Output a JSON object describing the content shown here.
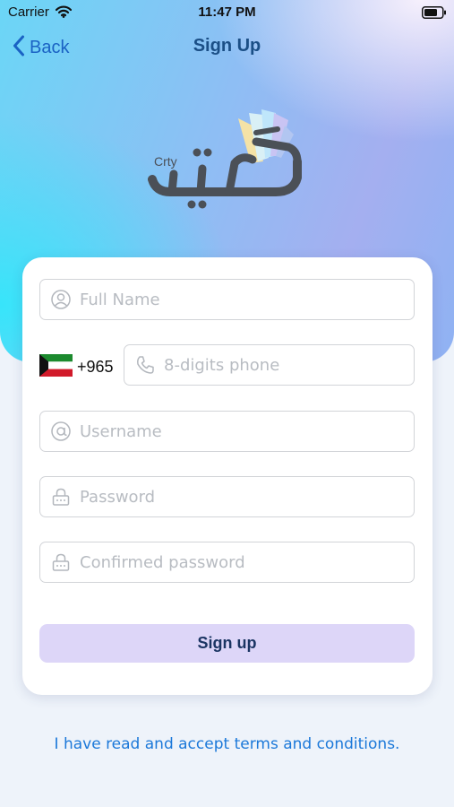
{
  "status_bar": {
    "carrier": "Carrier",
    "time": "11:47 PM",
    "icons": [
      "wifi-icon",
      "battery-icon"
    ]
  },
  "nav": {
    "back_label": "Back",
    "title": "Sign Up"
  },
  "logo": {
    "latin_text": "Crty",
    "arabic_text": "كرتي",
    "colors": {
      "wordmark": "#4b5057",
      "fan": [
        "#f4e2a6",
        "#d9f0f6",
        "#bfe6fb",
        "#c9c4f3",
        "#b2c6f1"
      ]
    }
  },
  "form": {
    "full_name": {
      "placeholder": "Full Name",
      "value": "",
      "icon": "user-icon"
    },
    "phone": {
      "country_flag": "kuwait-flag-icon",
      "country_code": "+965",
      "placeholder": "8-digits phone",
      "value": "",
      "icon": "phone-icon"
    },
    "username": {
      "placeholder": "Username",
      "value": "",
      "icon": "at-sign-icon"
    },
    "password": {
      "placeholder": "Password",
      "value": "",
      "icon": "lock-icon"
    },
    "confirm_password": {
      "placeholder": "Confirmed password",
      "value": "",
      "icon": "lock-icon"
    },
    "submit_label": "Sign up"
  },
  "terms_text": "I have read and accept terms and conditions.",
  "colors": {
    "accent": "#1a62c4",
    "title": "#1b4f86",
    "button_bg": "#ddd6f8",
    "button_text": "#1b3563",
    "link": "#1b78d9",
    "page_bg": "#eef3fa"
  }
}
